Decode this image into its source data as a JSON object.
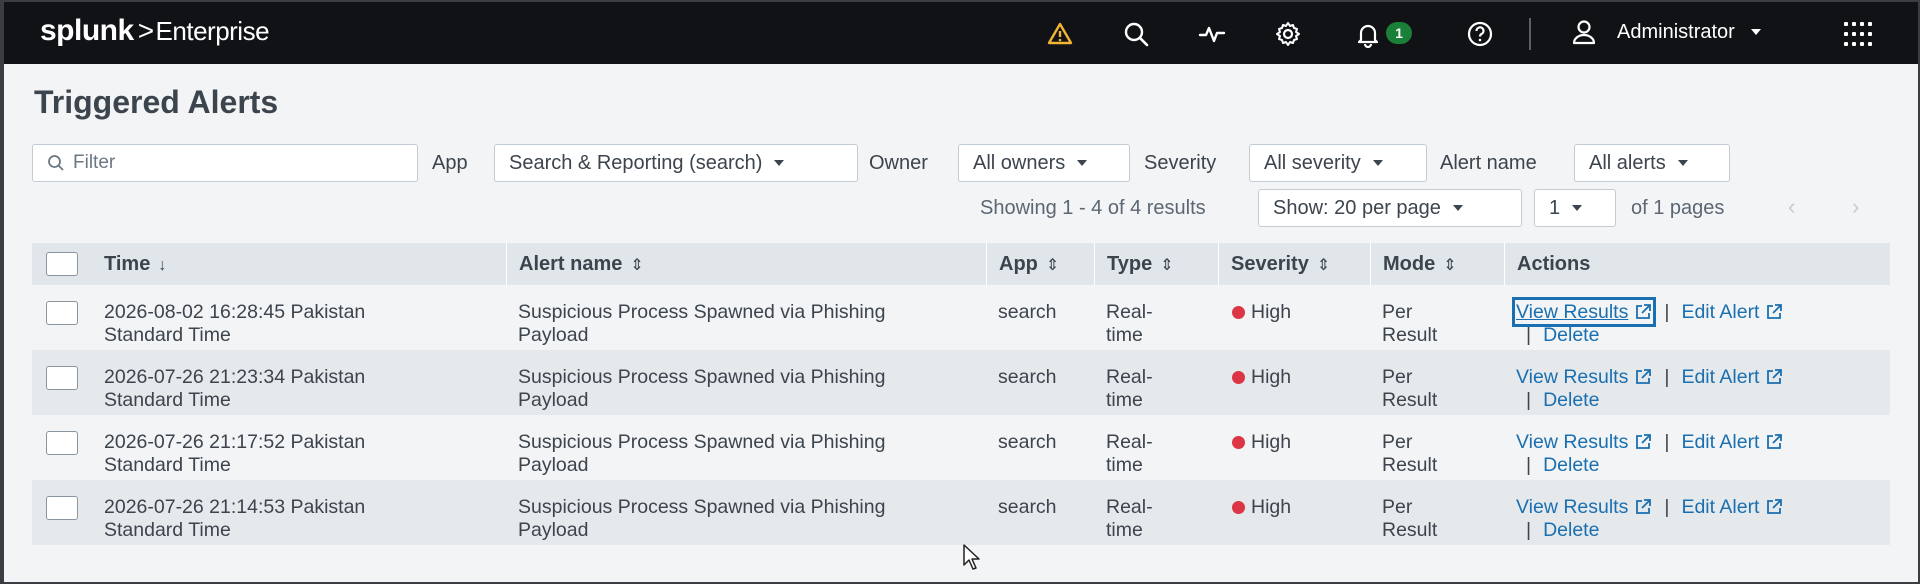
{
  "header": {
    "logo_brand": "splunk",
    "logo_sep": ">",
    "logo_product": "Enterprise",
    "notification_count": "1",
    "user_name": "Administrator",
    "icons": [
      "warning-icon",
      "search-icon",
      "activity-icon",
      "gear-icon",
      "bell-icon",
      "help-icon",
      "user-icon",
      "apps-grid-icon"
    ],
    "warning_color": "#f1b434"
  },
  "page": {
    "title": "Triggered Alerts"
  },
  "filters": {
    "filter_placeholder": "Filter",
    "app_label": "App",
    "app_value": "Search & Reporting (search)",
    "owner_label": "Owner",
    "owner_value": "All owners",
    "severity_label": "Severity",
    "severity_value": "All severity",
    "alert_name_label": "Alert name",
    "alert_name_value": "All alerts"
  },
  "pagination": {
    "showing": "Showing 1 - 4 of 4 results",
    "per_page": "Show: 20 per page",
    "page": "1",
    "of_pages": "of 1 pages",
    "prev": "‹",
    "next": "›"
  },
  "table": {
    "columns": {
      "time": "Time",
      "alert_name": "Alert name",
      "app": "App",
      "type": "Type",
      "severity": "Severity",
      "mode": "Mode",
      "actions": "Actions"
    },
    "sort_desc": "↓",
    "sortable": "⇕",
    "rows": [
      {
        "time_line1": "2026-08-02 16:28:45 Pakistan",
        "time_line2": "Standard Time",
        "alert_line1": "Suspicious Process Spawned via Phishing",
        "alert_line2": "Payload",
        "app": "search",
        "type_line1": "Real-",
        "type_line2": "time",
        "severity": "High",
        "mode_line1": "Per",
        "mode_line2": "Result",
        "view_results": "View Results",
        "edit_alert": "Edit Alert",
        "delete": "Delete"
      },
      {
        "time_line1": "2026-07-26 21:23:34 Pakistan",
        "time_line2": "Standard Time",
        "alert_line1": "Suspicious Process Spawned via Phishing",
        "alert_line2": "Payload",
        "app": "search",
        "type_line1": "Real-",
        "type_line2": "time",
        "severity": "High",
        "mode_line1": "Per",
        "mode_line2": "Result",
        "view_results": "View Results",
        "edit_alert": "Edit Alert",
        "delete": "Delete"
      },
      {
        "time_line1": "2026-07-26 21:17:52 Pakistan",
        "time_line2": "Standard Time",
        "alert_line1": "Suspicious Process Spawned via Phishing",
        "alert_line2": "Payload",
        "app": "search",
        "type_line1": "Real-",
        "type_line2": "time",
        "severity": "High",
        "mode_line1": "Per",
        "mode_line2": "Result",
        "view_results": "View Results",
        "edit_alert": "Edit Alert",
        "delete": "Delete"
      },
      {
        "time_line1": "2026-07-26 21:14:53 Pakistan",
        "time_line2": "Standard Time",
        "alert_line1": "Suspicious Process Spawned via Phishing",
        "alert_line2": "Payload",
        "app": "search",
        "type_line1": "Real-",
        "type_line2": "time",
        "severity": "High",
        "mode_line1": "Per",
        "mode_line2": "Result",
        "view_results": "View Results",
        "edit_alert": "Edit Alert",
        "delete": "Delete"
      }
    ],
    "severity_color": "#dc3545",
    "link_color": "#1a6fb0"
  }
}
